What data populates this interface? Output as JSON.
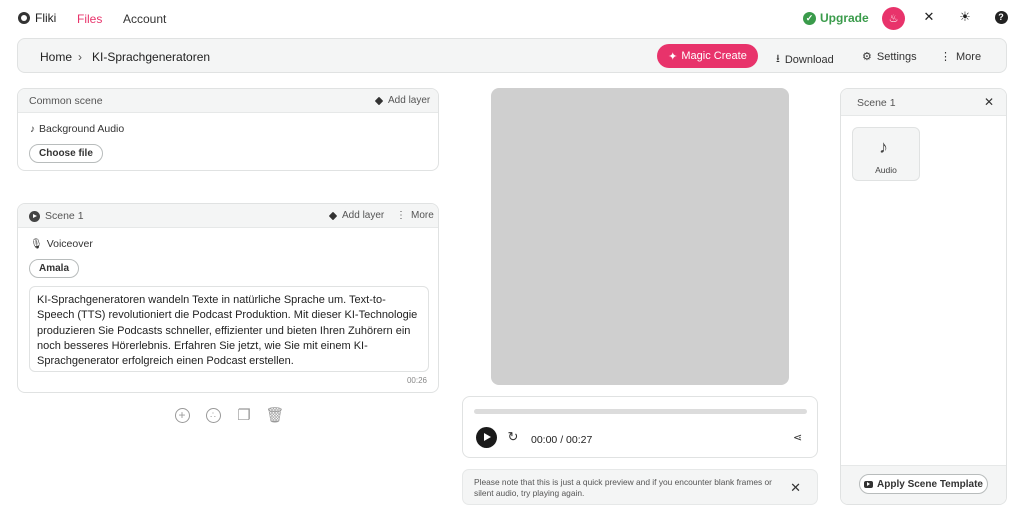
{
  "nav": {
    "brand": "Fliki",
    "files": "Files",
    "account": "Account",
    "upgrade": "Upgrade"
  },
  "toolbar": {
    "home": "Home",
    "separator": "›",
    "project": "KI-Sprachgeneratoren",
    "magic_create": "Magic Create",
    "download": "Download",
    "settings": "Settings",
    "more": "More"
  },
  "common_scene": {
    "title": "Common scene",
    "add_layer": "Add layer",
    "background_audio": "Background Audio",
    "choose_file": "Choose file"
  },
  "scene1": {
    "title": "Scene 1",
    "add_layer": "Add layer",
    "more": "More",
    "voiceover": "Voiceover",
    "voice": "Amala",
    "text": "KI-Sprachgeneratoren wandeln Texte in natürliche Sprache um. Text-to-Speech (TTS) revolutioniert die Podcast Produktion. Mit dieser KI-Technologie produzieren Sie Podcasts schneller, effizienter und bieten Ihren Zuhörern ein noch besseres Hörerlebnis. Erfahren Sie jetzt, wie Sie mit einem KI-Sprachgenerator erfolgreich einen Podcast erstellen.",
    "duration": "00:26"
  },
  "player": {
    "time": "00:00 / 00:27",
    "progress": 0
  },
  "notice": {
    "text": "Please note that this is just a quick preview and if you encounter blank frames or silent audio, try playing again."
  },
  "right_panel": {
    "title": "Scene 1",
    "tile_label": "Audio",
    "apply_template": "Apply Scene Template"
  },
  "colors": {
    "accent": "#e8336b",
    "upgrade": "#3a9b4b",
    "preview_bg": "#cfcfcf"
  }
}
